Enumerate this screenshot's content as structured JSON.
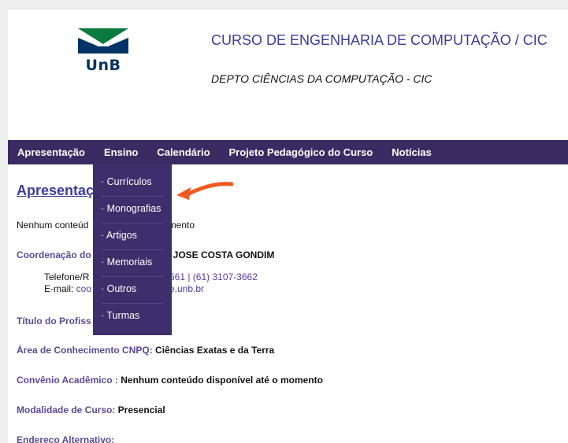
{
  "header": {
    "logo_text": "UnB",
    "course_title": "CURSO DE ENGENHARIA DE COMPUTAÇÃO / CIC",
    "dept_title": "DEPTO CIÊNCIAS DA COMPUTAÇÃO - CIC"
  },
  "nav": {
    "items": [
      {
        "label": "Apresentação"
      },
      {
        "label": "Ensino"
      },
      {
        "label": "Calendário"
      },
      {
        "label": "Projeto Pedagógico do Curso"
      },
      {
        "label": "Notícias"
      }
    ],
    "dropdown": [
      {
        "label": "· Currículos"
      },
      {
        "label": "· Monografias"
      },
      {
        "label": "· Artigos"
      },
      {
        "label": "· Memoriais"
      },
      {
        "label": "· Outros"
      },
      {
        "label": "· Turmas"
      }
    ]
  },
  "content": {
    "title": "Apresentaç",
    "intro_left": "Nenhum conteúd",
    "intro_right": "momento",
    "coord_label": "Coordenação do",
    "coord_value": "O JOSE COSTA GONDIM",
    "phone_label": "Telefone/R",
    "phone_value": "661 | (61) 3107-3662",
    "email_label": "E-mail: ",
    "email_left": "coo",
    "email_right": "e.unb.br",
    "titulo_label": "Título do Profiss",
    "area_label": "Área de Conhecimento CNPQ:",
    "area_value": " Ciências Exatas e da Terra",
    "convenio_label": "Convênio Acadêmico :",
    "convenio_value": " Nenhum conteúdo disponível até o momento",
    "modalidade_label": "Modalidade de Curso:",
    "modalidade_value": " Presencial",
    "endereco_label": "Endereço Alternativo:"
  },
  "colors": {
    "navbar": "#3a2c63",
    "link": "#3d3c9e",
    "label": "#5a4a96",
    "arrow": "#f05a22",
    "logo_green": "#0a7a3e",
    "logo_blue": "#003366"
  }
}
